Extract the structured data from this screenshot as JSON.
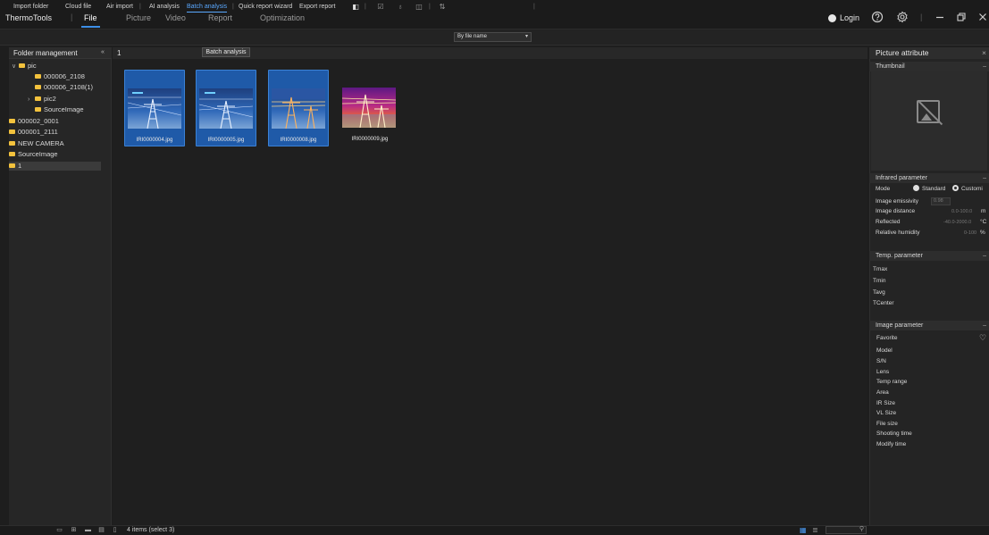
{
  "app": {
    "name": "ThermoTools"
  },
  "menu": {
    "tabs": [
      "File",
      "Picture",
      "Video",
      "Report",
      "Optimization"
    ],
    "active": "File",
    "login": "Login"
  },
  "toolbar": {
    "import_folder": "Import folder",
    "cloud_file": "Cloud file",
    "air_import": "Air import",
    "ai_analysis": "AI analysis",
    "batch_analysis": "Batch analysis",
    "quick_report_wizard": "Quick report wizard",
    "export_report": "Export report",
    "separator": "|",
    "sort_select": "By file name",
    "tooltip": "Batch analysis"
  },
  "folder_panel": {
    "title": "Folder management",
    "collapse": "«",
    "tree": [
      {
        "label": "pic",
        "caret": "∨"
      },
      {
        "label": "000006_2108"
      },
      {
        "label": "000006_2108(1)"
      },
      {
        "label": "pic2",
        "caret": "›"
      },
      {
        "label": "SourceImage"
      },
      {
        "label": "000002_0001"
      },
      {
        "label": "000001_2111"
      },
      {
        "label": "NEW CAMERA"
      },
      {
        "label": "SourceImage"
      },
      {
        "label": "1"
      }
    ]
  },
  "content": {
    "title": "1",
    "images": [
      {
        "name": "IRI0000004.jpg",
        "selected": true,
        "palette": "ir-blue"
      },
      {
        "name": "IRI0000005.jpg",
        "selected": true,
        "palette": "ir-blue"
      },
      {
        "name": "IRI0000008.jpg",
        "selected": true,
        "palette": "ir-blue"
      },
      {
        "name": "IRI0000009.jpg",
        "selected": false,
        "palette": "ir-heat"
      }
    ]
  },
  "picture_attribute": {
    "title": "Picture attribute",
    "close": "×",
    "thumbnail": "Thumbnail",
    "infrared": {
      "title": "Infrared parameter",
      "mode_label": "Mode",
      "mode_standard": "Standard",
      "mode_custom": "Customi",
      "emissivity_label": "Image emissivity",
      "emissivity_value": "0.98",
      "distance_label": "Image distance",
      "distance_range": "0.0-100.0",
      "distance_unit": "m",
      "reflected_label": "Reflected",
      "reflected_range": "-40.0-2000.0",
      "reflected_unit": "°C",
      "humidity_label": "Relative humidity",
      "humidity_range": "0-100",
      "humidity_unit": "%"
    },
    "temp": {
      "title": "Temp. parameter",
      "rows": [
        "Tmax",
        "Tmin",
        "Tavg",
        "TCenter"
      ]
    },
    "image": {
      "title": "Image parameter",
      "rows": [
        "Favorite",
        "Model",
        "S/N",
        "Lens",
        "Temp range",
        "Area",
        "IR Size",
        "VL Size",
        "File size",
        "Shooting time",
        "Modify time"
      ]
    }
  },
  "status": {
    "text": "4 items (select 3)"
  },
  "colors": {
    "accent": "#3d8ee6",
    "selection": "#1f5aa8",
    "folder": "#f3c23d"
  }
}
